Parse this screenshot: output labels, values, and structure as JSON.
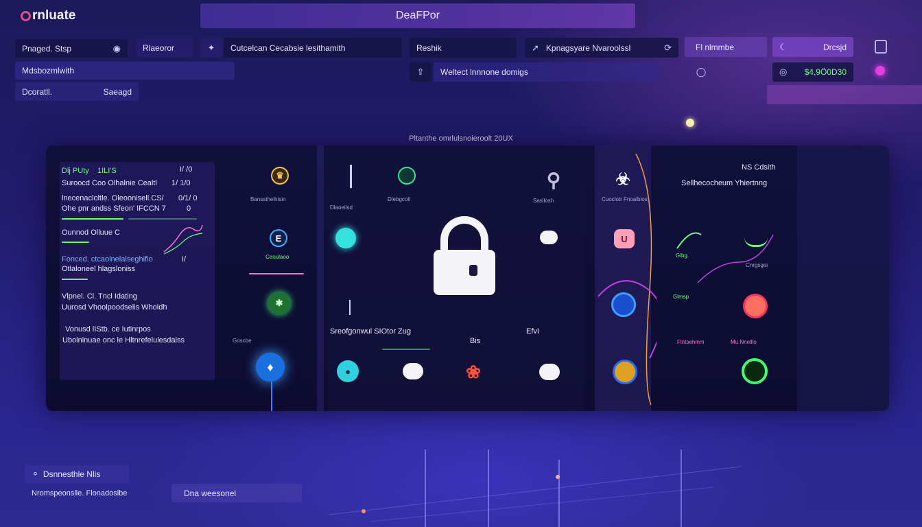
{
  "app": {
    "logo_text": "rnluate",
    "title": "DeaFPor"
  },
  "toolbar": {
    "field1": "Pnaged. Stsp",
    "field2": "Rlaeoror",
    "field3": "Cutcelcan Cecabsie lesithamith",
    "field4": "Reshik",
    "field5": "Kpnagsyare Nvaroolssl",
    "tab1": "Fl nlmmbe",
    "tab2": "Drcsjd",
    "row2_left": "Mdsbozmlwith",
    "search": "Weltect lnnnone domigs",
    "balance": "$4,9Ö0D30",
    "row3_a": "Dcoratll.",
    "row3_b": "Saeagd"
  },
  "panel": {
    "heading": "Pltanthe omrlulsnoieroolt 20UX",
    "left": {
      "line1a": "Dlj PUty",
      "line1b": "1ILI'S",
      "line1c": "I/ /0",
      "line2a": "Suroocd Coo Olhalnie Cealtl",
      "line2b": "1/ 1/0",
      "line3a": "lnecenacloltle. Oleoonisell.CS/",
      "line3b": "0/1/ 0",
      "line4a": "Ohe  pnr andss Sfeon'  IFCCN 7",
      "line4b": "0",
      "line5": "Ounnod Olluue C",
      "line6": "Fonced.  ctcaolnelalseghifio",
      "line6b": "I/",
      "line7": "Otlaloneel hlagsloniss",
      "line8": "Vlpnel. Cl. Tncl Idating",
      "line9": "Uurosd Vhoolpoodselis Wholdh",
      "line10": "Vonusd lIStb. ce Iutinrpos",
      "line11": "Ubolnlnuae onc le Hltnrefelulesdalss"
    },
    "center_caption": "Sreofgonwul  SIOtor  Zug",
    "center_b": "Bis",
    "right_caption": "EfvI",
    "right_heading": "Sellhecocheum Yhiertnng",
    "right_badge": "NS Cdsith",
    "right_tags": [
      "Glbg.",
      "Cnrgsgei",
      "Glmsp",
      "Flntsehmm",
      "Mu Nnelllo"
    ],
    "node_labels": [
      "Bansstheihisin",
      "Ceoulaoo",
      "Goscbe",
      "Dlaoeilsd",
      "Dlebgcoll",
      "Sasllosh",
      "Cuoclotr Fnoalbios"
    ]
  },
  "footer": {
    "item1": "Dsnnesthle Nlis",
    "item2": "Nromspeonslle. Flonadoslbe",
    "item3": "Dna weesonel"
  },
  "colors": {
    "accent_green": "#6dff7a",
    "accent_pink": "#ff6fd8",
    "accent_cyan": "#35e0e0",
    "panel_bg": "#10103a"
  }
}
